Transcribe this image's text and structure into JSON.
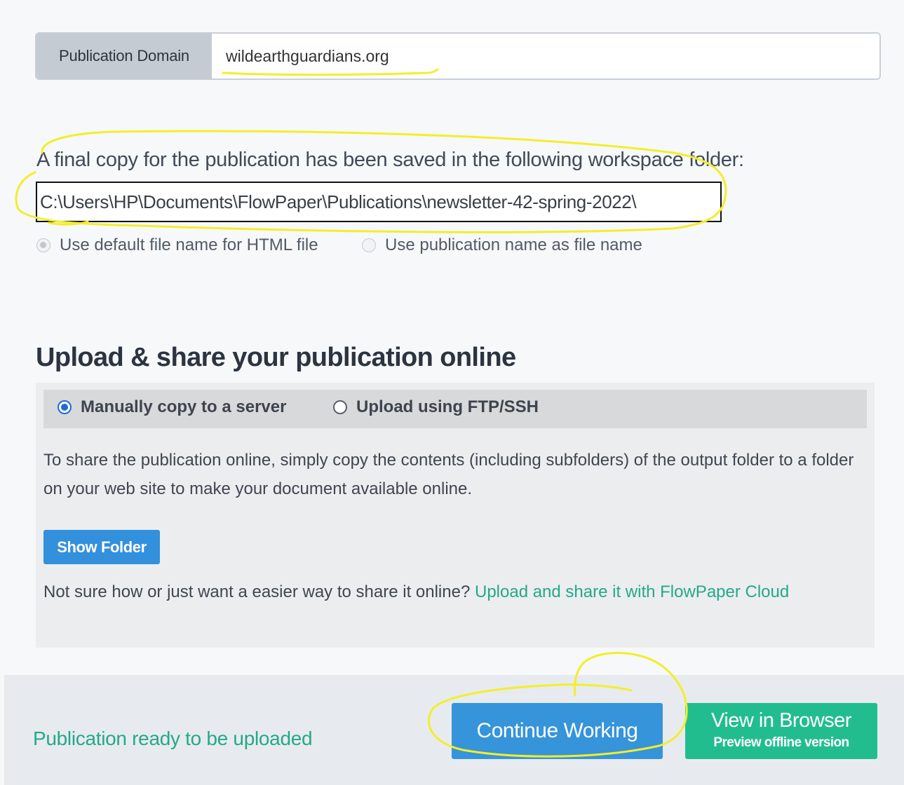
{
  "publication_domain": {
    "label": "Publication Domain",
    "value": "wildearthguardians.org"
  },
  "saved_copy": {
    "message": "A final copy for the publication has been saved in the following workspace folder:",
    "path": "C:\\Users\\HP\\Documents\\FlowPaper\\Publications\\newsletter-42-spring-2022\\"
  },
  "file_name_options": {
    "default": "Use default file name for HTML file",
    "publication": "Use publication name as file name",
    "selected": "default"
  },
  "upload": {
    "title": "Upload & share your publication online",
    "methods": [
      {
        "label": "Manually copy to a server",
        "selected": true
      },
      {
        "label": "Upload using FTP/SSH",
        "selected": false
      }
    ],
    "description": "To share the publication online, simply copy the contents (including subfolders) of the output folder to a folder on your web site to make your document available online.",
    "show_folder_label": "Show Folder",
    "alt_prompt": "Not sure how or just want a easier way to share it online?",
    "cloud_link": "Upload and share it with FlowPaper Cloud"
  },
  "footer": {
    "status": "Publication ready to be uploaded",
    "continue_label": "Continue Working",
    "view_label": "View in Browser",
    "view_sublabel": "Preview offline version"
  },
  "colors": {
    "accent_blue": "#3694da",
    "accent_green": "#22bd8f",
    "link_green": "#22a98a",
    "highlight_annotation": "#f3ee2a"
  }
}
